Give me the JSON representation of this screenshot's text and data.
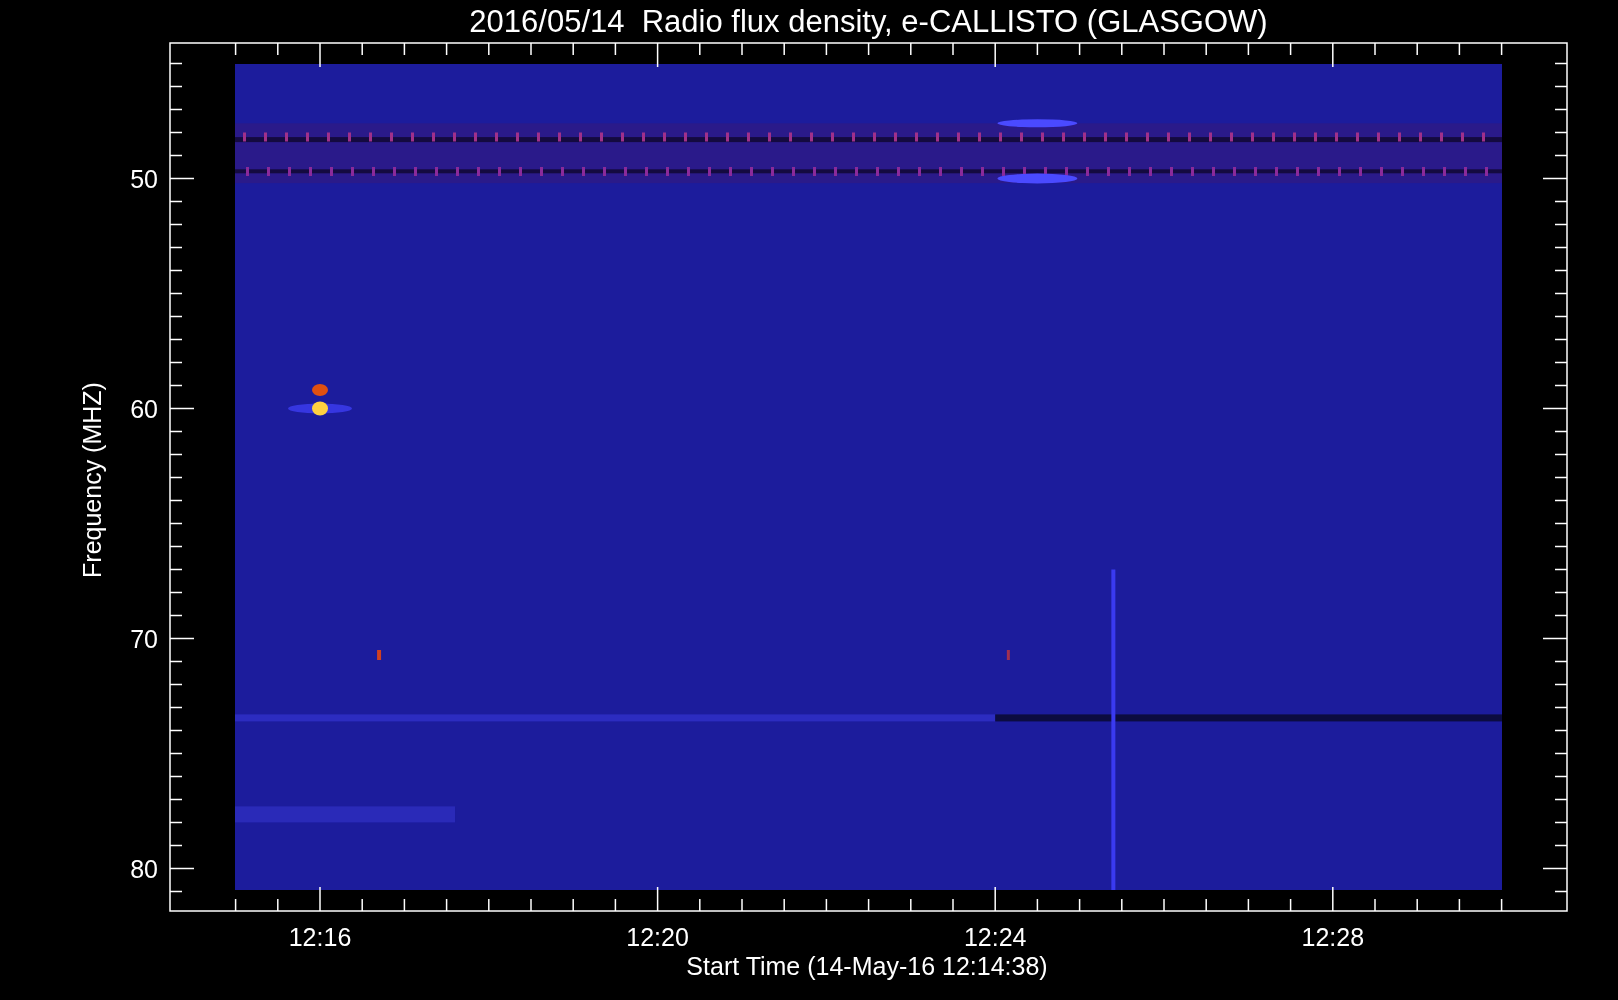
{
  "title": "2016/05/14  Radio flux density, e-CALLISTO (GLASGOW)",
  "y_axis": {
    "label": "Frequency (MHZ)",
    "ticks": [
      "50",
      "60",
      "70",
      "80"
    ]
  },
  "x_axis": {
    "label": "Start Time (14-May-16 12:14:38)",
    "ticks": [
      "12:16",
      "12:20",
      "12:24",
      "12:28"
    ]
  }
}
